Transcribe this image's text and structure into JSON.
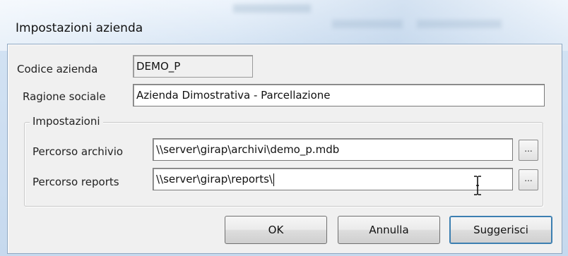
{
  "window": {
    "title": "Impostazioni azienda"
  },
  "form": {
    "codice_label": "Codice azienda",
    "codice_value": "DEMO_P",
    "ragione_label": "Ragione sociale",
    "ragione_value": "Azienda Dimostrativa - Parcellazione",
    "group_title": "Impostazioni",
    "archivio_label": "Percorso archivio",
    "archivio_value": "\\\\server\\girap\\archivi\\demo_p.mdb",
    "reports_label": "Percorso reports",
    "reports_value": "\\\\server\\girap\\reports\\",
    "browse_label": "..."
  },
  "buttons": {
    "ok": "OK",
    "annulla": "Annulla",
    "suggerisci": "Suggerisci"
  },
  "icons": {
    "cursor": "ibeam-cursor-icon"
  }
}
